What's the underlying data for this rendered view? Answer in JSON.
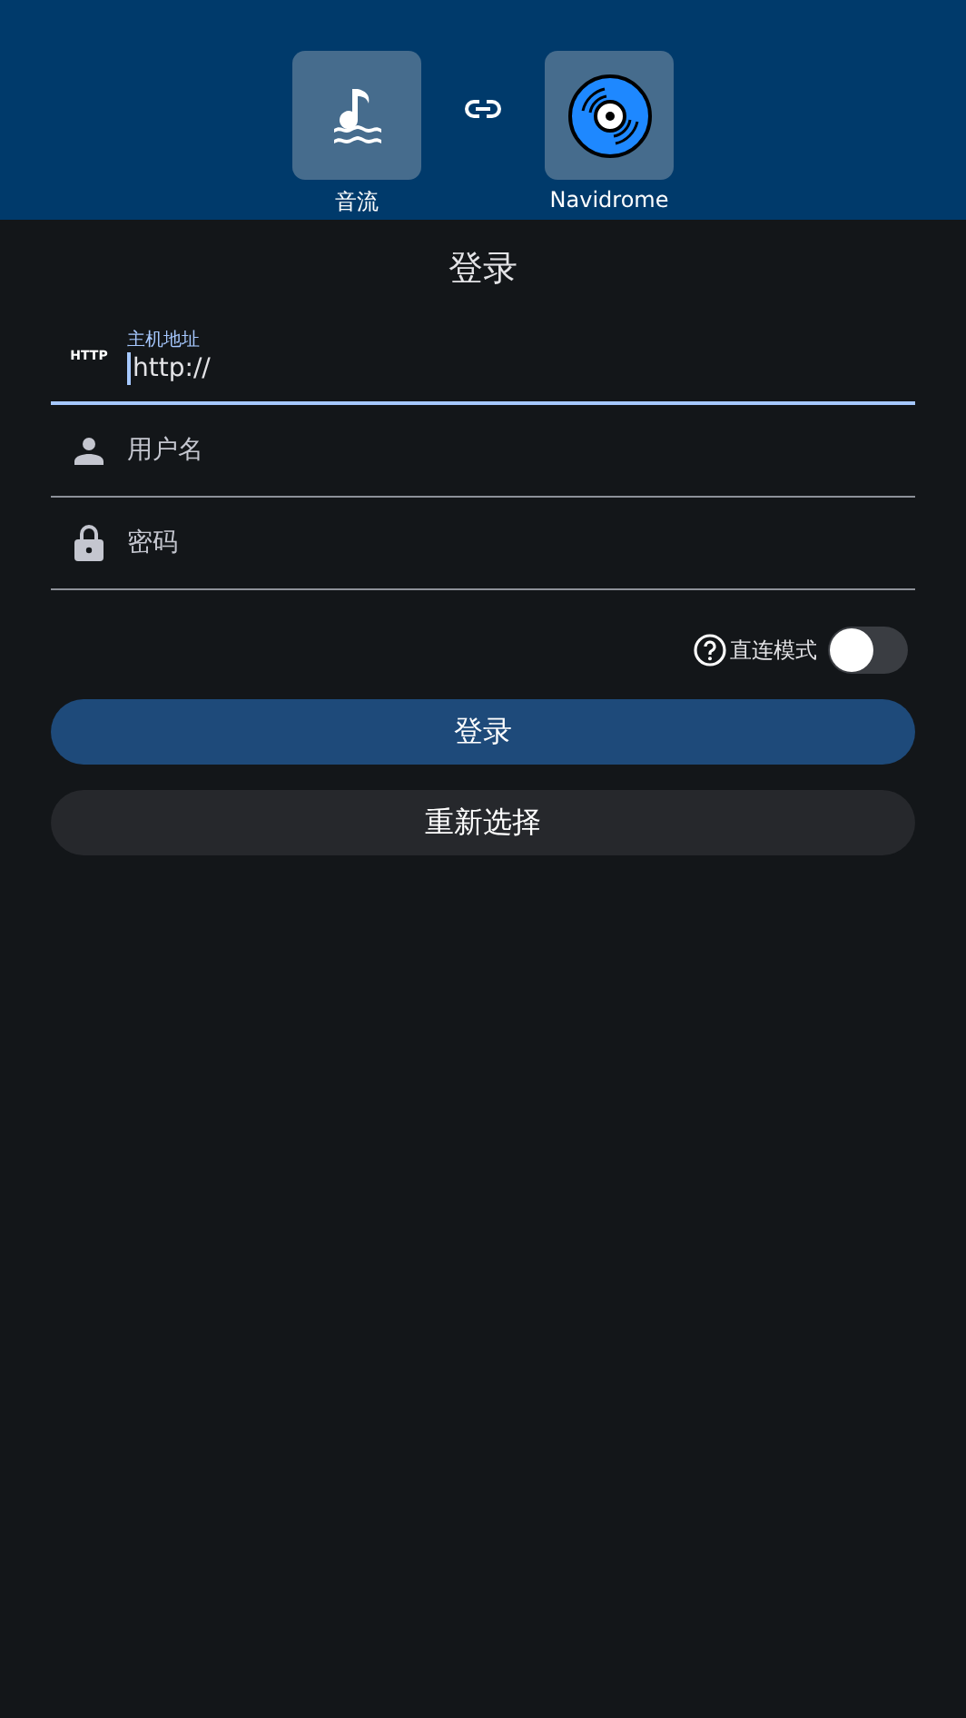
{
  "header": {
    "apps": [
      {
        "kind": "music",
        "label": "音流"
      },
      {
        "kind": "disc",
        "label": "Navidrome"
      }
    ]
  },
  "title": "登录",
  "fields": [
    {
      "kind": "host",
      "prefix": "HTTP",
      "label": "主机地址",
      "value": "http://",
      "focused": true
    },
    {
      "kind": "user",
      "placeholder": "用户名",
      "focused": false
    },
    {
      "kind": "password",
      "placeholder": "密码",
      "focused": false
    }
  ],
  "direct_mode": {
    "label": "直连模式",
    "on": false
  },
  "buttons": [
    {
      "kind": "primary",
      "label": "登录"
    },
    {
      "kind": "secondary",
      "label": "重新选择"
    }
  ]
}
